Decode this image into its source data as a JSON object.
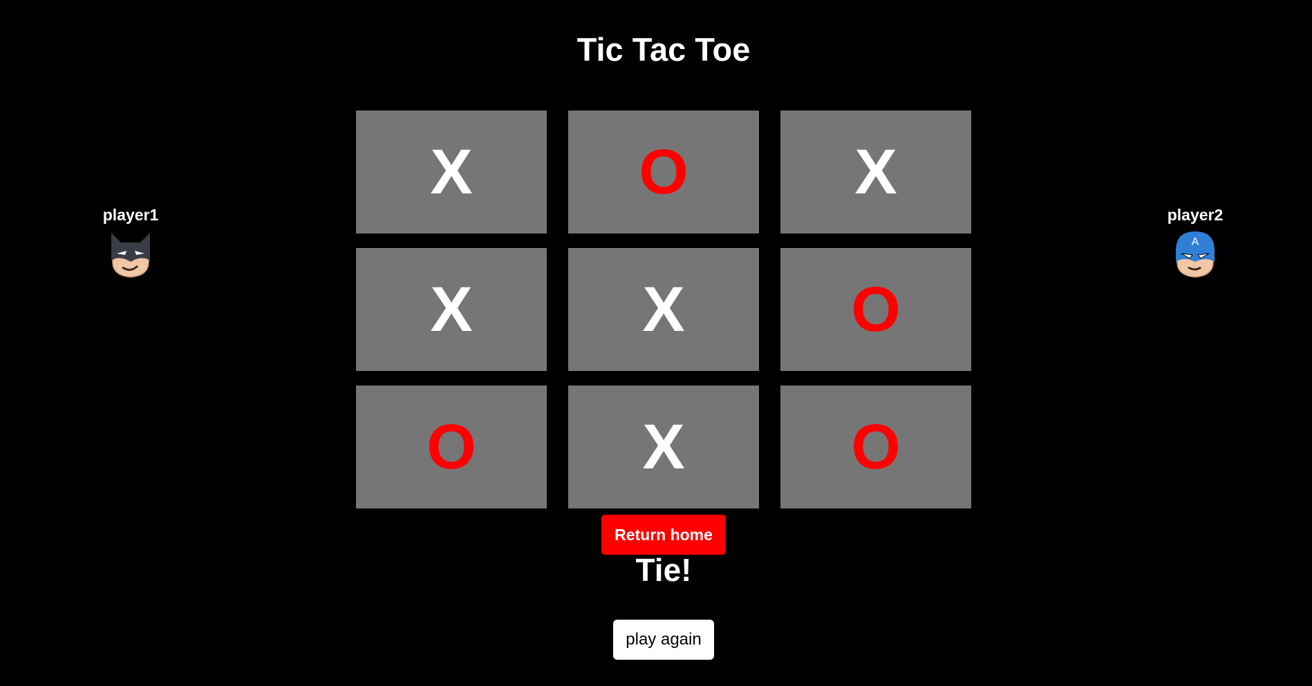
{
  "header": {
    "title": "Tic Tac Toe"
  },
  "players": [
    {
      "name": "player1",
      "avatar_icon": "batman-mask-icon"
    },
    {
      "name": "player2",
      "avatar_icon": "captain-america-mask-icon"
    }
  ],
  "board": {
    "cells": [
      "X",
      "O",
      "X",
      "X",
      "X",
      "O",
      "O",
      "X",
      "O"
    ]
  },
  "actions": {
    "return_home_label": "Return home",
    "play_again_label": "play again"
  },
  "status": {
    "result": "Tie!"
  },
  "colors": {
    "background": "#000000",
    "cell": "#767676",
    "x_mark": "#ffffff",
    "o_mark": "#ff0000",
    "return_button": "#ff0000",
    "play_again_button": "#ffffff"
  }
}
